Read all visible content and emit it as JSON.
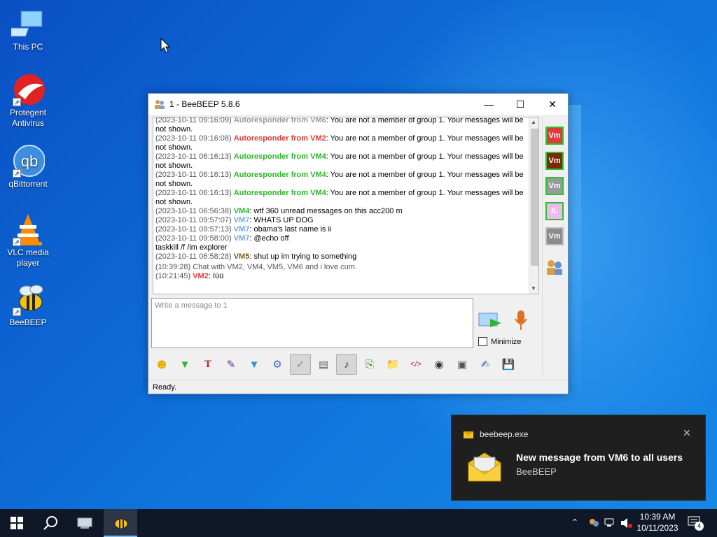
{
  "desktop": {
    "icons": [
      {
        "label": "This PC"
      },
      {
        "label": "Protegent Antivirus"
      },
      {
        "label": "qBittorrent"
      },
      {
        "label": "VLC media player"
      },
      {
        "label": "BeeBEEP"
      }
    ]
  },
  "window": {
    "title": "1 - BeeBEEP 5.8.6",
    "messages": [
      {
        "ts": "(2023-10-11 09:16:09) ",
        "who": "Autoresponder from VM6",
        "color": "#9a9a9a",
        "text": ": You are not a member of group 1. Your messages will be not shown."
      },
      {
        "ts": "(2023-10-11 09:16:08) ",
        "who": "Autoresponder from VM2",
        "color": "#e03a3a",
        "text": ": You are not a member of group 1. Your messages will be not shown."
      },
      {
        "ts": "(2023-10-11 06:16:13) ",
        "who": "Autoresponder from VM4",
        "color": "#2db52d",
        "text": ": You are not a member of group 1. Your messages will be not shown."
      },
      {
        "ts": "(2023-10-11 06:16:13) ",
        "who": "Autoresponder from VM4",
        "color": "#2db52d",
        "text": ": You are not a member of group 1. Your messages will be not shown."
      },
      {
        "ts": "(2023-10-11 06:16:13) ",
        "who": "Autoresponder from VM4",
        "color": "#2db52d",
        "text": ": You are not a member of group 1. Your messages will be not shown."
      },
      {
        "ts": "(2023-10-11 06:56:38) ",
        "who": "VM4",
        "color": "#2db52d",
        "text": ": wtf 360 unread messages on this acc200 m"
      },
      {
        "ts": "(2023-10-11 09:57:07) ",
        "who": "VM7",
        "color": "#6aa6e0",
        "text": ": WHATS UP DOG"
      },
      {
        "ts": "(2023-10-11 09:57:13) ",
        "who": "VM7",
        "color": "#6aa6e0",
        "text": ": obama's last name is ii"
      },
      {
        "ts": "(2023-10-11 09:58:00) ",
        "who": "VM7",
        "color": "#6aa6e0",
        "text": ": @echo off\ntaskkill /f /im explorer"
      },
      {
        "ts": "(2023-10-11 06:58:28) ",
        "who": "VM5",
        "color": "#7a5a10",
        "text": ": shut up im trying to something"
      }
    ],
    "system_line": {
      "ts": "(10:39:28) ",
      "text": "Chat with VM2, VM4, VM5, VM6 and i love cum."
    },
    "last_line": {
      "ts": "(10:21:45) ",
      "who": "VM2",
      "color": "#e03a3a",
      "text": ": ïúü"
    },
    "users": [
      {
        "label": "Vm",
        "bg": "#e23a3a"
      },
      {
        "label": "Vm",
        "bg": "#7a2a08"
      },
      {
        "label": "Vm",
        "bg": "#9a9a9a"
      },
      {
        "label": "IL",
        "bg": "#f0b8f0"
      },
      {
        "label": "Vm",
        "bg": "#8c8c8c"
      }
    ],
    "input_placeholder": "Write a message to 1",
    "minimize_label": "Minimize",
    "status": "Ready."
  },
  "toast": {
    "app": "beebeep.exe",
    "title": "New message from VM6 to all users",
    "subtitle": "BeeBEEP"
  },
  "taskbar": {
    "time": "10:39 AM",
    "date": "10/11/2023",
    "notification_count": "4"
  }
}
